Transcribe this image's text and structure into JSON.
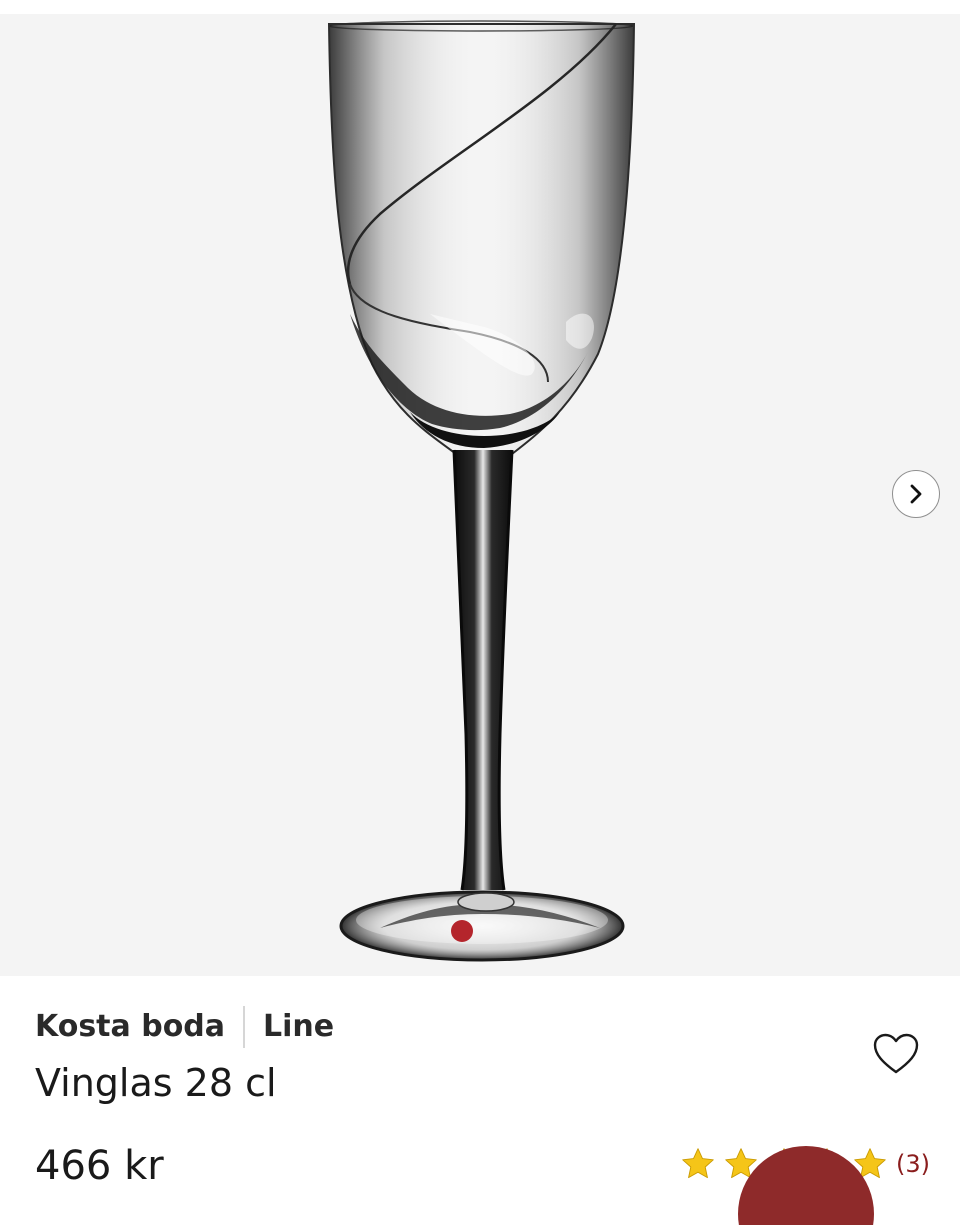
{
  "product": {
    "brand": "Kosta boda",
    "collection": "Line",
    "title": "Vinglas 28 cl",
    "price": "466 kr"
  },
  "rating": {
    "stars": 5,
    "count_label": "(3)",
    "star_color": "#f5c518"
  },
  "icons": {
    "next": "chevron-right-icon",
    "favorite": "heart-outline-icon",
    "help": "chat-help-icon"
  },
  "colors": {
    "gallery_background": "#f4f4f4",
    "review_count": "#8a1d1d",
    "help_button": "#8e2a2a",
    "glass_marker": "#b4252c"
  }
}
